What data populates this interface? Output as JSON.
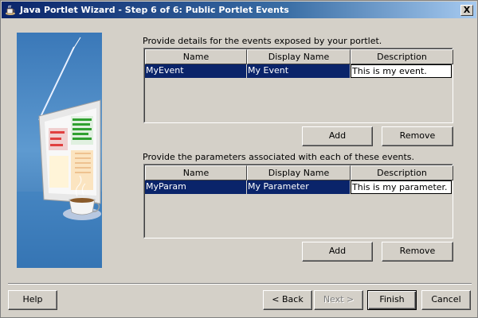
{
  "window": {
    "title": "Java Portlet Wizard - Step 6 of 6: Public Portlet Events",
    "close_label": "X"
  },
  "events": {
    "instruction": "Provide details for the events exposed by your portlet.",
    "columns": [
      "Name",
      "Display Name",
      "Description"
    ],
    "rows": [
      {
        "name": "MyEvent",
        "display_name": "My Event",
        "description": "This is my event."
      }
    ],
    "add_label": "Add",
    "remove_label": "Remove"
  },
  "parameters": {
    "instruction": "Provide the parameters associated with each of these events.",
    "columns": [
      "Name",
      "Display Name",
      "Description"
    ],
    "rows": [
      {
        "name": "MyParam",
        "display_name": "My Parameter",
        "description": "This is my parameter."
      }
    ],
    "add_label": "Add",
    "remove_label": "Remove"
  },
  "footer": {
    "help_label": "Help",
    "back_label": "< Back",
    "next_label": "Next >",
    "finish_label": "Finish",
    "cancel_label": "Cancel"
  },
  "colors": {
    "selection": "#0a246a",
    "dialog_bg": "#d4d0c8",
    "title_gradient_start": "#0a246a",
    "title_gradient_end": "#a6caf0"
  },
  "icons": {
    "title": "coffee-cup-icon",
    "side": "wizard-side-illustration"
  }
}
